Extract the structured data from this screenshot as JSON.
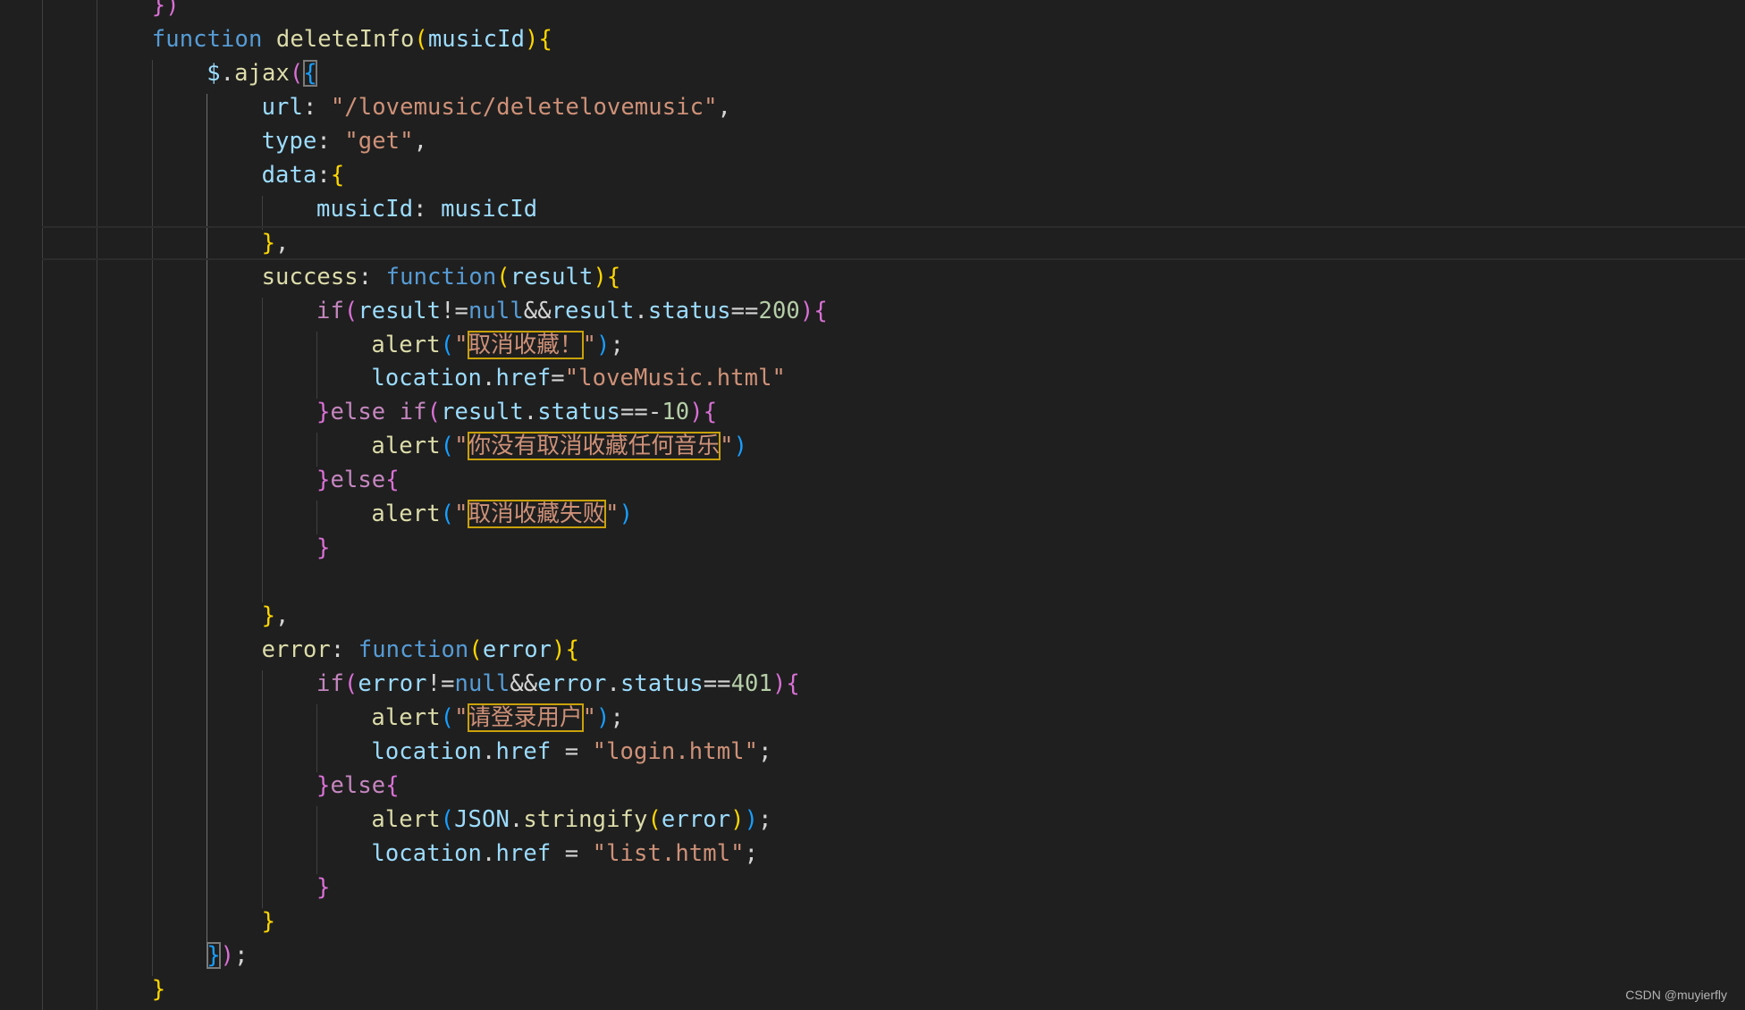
{
  "colors": {
    "background": "#1f1f1f",
    "keyword_storage": "#569cd6",
    "keyword_control": "#c586c0",
    "function_name": "#dcdcaa",
    "variable": "#9cdcfe",
    "string": "#ce9178",
    "number": "#b5cea8",
    "punct": "#d4d4d4",
    "bracket1": "#ffd700",
    "bracket2": "#da70d6",
    "bracket3": "#179fff",
    "highlight_box": "#c9a10a"
  },
  "code_lines": [
    {
      "indent": 2,
      "tokens": [
        [
          "})",
          "b2"
        ]
      ]
    },
    {
      "indent": 2,
      "tokens": [
        [
          "function ",
          "kw"
        ],
        [
          "deleteInfo",
          "fn"
        ],
        [
          "(",
          "b1"
        ],
        [
          "musicId",
          "var"
        ],
        [
          ")",
          "b1"
        ],
        [
          "{",
          "b1"
        ]
      ]
    },
    {
      "indent": 3,
      "tokens": [
        [
          "$",
          "var"
        ],
        [
          ".",
          "p"
        ],
        [
          "ajax",
          "fn"
        ],
        [
          "(",
          "b2"
        ],
        [
          "{",
          "b3",
          "match"
        ]
      ]
    },
    {
      "indent": 4,
      "tokens": [
        [
          "url",
          "var"
        ],
        [
          ": ",
          "p"
        ],
        [
          "\"/lovemusic/deletelovemusic\"",
          "str"
        ],
        [
          ",",
          "p"
        ]
      ]
    },
    {
      "indent": 4,
      "tokens": [
        [
          "type",
          "var"
        ],
        [
          ": ",
          "p"
        ],
        [
          "\"get\"",
          "str"
        ],
        [
          ",",
          "p"
        ]
      ]
    },
    {
      "indent": 4,
      "tokens": [
        [
          "data",
          "var"
        ],
        [
          ":",
          "p"
        ],
        [
          "{",
          "b1"
        ]
      ]
    },
    {
      "indent": 5,
      "tokens": [
        [
          "musicId",
          "var"
        ],
        [
          ": ",
          "p"
        ],
        [
          "musicId",
          "var"
        ]
      ]
    },
    {
      "indent": 4,
      "tokens": [
        [
          "}",
          "b1"
        ],
        [
          ",",
          "p"
        ]
      ]
    },
    {
      "indent": 4,
      "tokens": [
        [
          "success",
          "fn"
        ],
        [
          ": ",
          "p"
        ],
        [
          "function",
          "kw"
        ],
        [
          "(",
          "b1"
        ],
        [
          "result",
          "var"
        ],
        [
          ")",
          "b1"
        ],
        [
          "{",
          "b1"
        ]
      ]
    },
    {
      "indent": 5,
      "tokens": [
        [
          "if",
          "ctl"
        ],
        [
          "(",
          "b2"
        ],
        [
          "result",
          "var"
        ],
        [
          "!=",
          "p"
        ],
        [
          "null",
          "kw"
        ],
        [
          "&&",
          "p"
        ],
        [
          "result",
          "var"
        ],
        [
          ".",
          "p"
        ],
        [
          "status",
          "var"
        ],
        [
          "==",
          "p"
        ],
        [
          "200",
          "num"
        ],
        [
          ")",
          "b2"
        ],
        [
          "{",
          "b2"
        ]
      ]
    },
    {
      "indent": 6,
      "tokens": [
        [
          "alert",
          "fn"
        ],
        [
          "(",
          "b3"
        ],
        [
          "\"",
          "str"
        ],
        [
          "取消收藏！",
          "str",
          "box"
        ],
        [
          "\"",
          "str"
        ],
        [
          ")",
          "b3"
        ],
        [
          ";",
          "p"
        ]
      ]
    },
    {
      "indent": 6,
      "tokens": [
        [
          "location",
          "var"
        ],
        [
          ".",
          "p"
        ],
        [
          "href",
          "var"
        ],
        [
          "=",
          "p"
        ],
        [
          "\"loveMusic.html\"",
          "str"
        ]
      ]
    },
    {
      "indent": 5,
      "tokens": [
        [
          "}",
          "b2"
        ],
        [
          "else ",
          "ctl"
        ],
        [
          "if",
          "ctl"
        ],
        [
          "(",
          "b2"
        ],
        [
          "result",
          "var"
        ],
        [
          ".",
          "p"
        ],
        [
          "status",
          "var"
        ],
        [
          "==-",
          "p"
        ],
        [
          "10",
          "num"
        ],
        [
          ")",
          "b2"
        ],
        [
          "{",
          "b2"
        ]
      ]
    },
    {
      "indent": 6,
      "tokens": [
        [
          "alert",
          "fn"
        ],
        [
          "(",
          "b3"
        ],
        [
          "\"",
          "str"
        ],
        [
          "你没有取消收藏任何音乐",
          "str",
          "box"
        ],
        [
          "\"",
          "str"
        ],
        [
          ")",
          "b3"
        ]
      ]
    },
    {
      "indent": 5,
      "tokens": [
        [
          "}",
          "b2"
        ],
        [
          "else",
          "ctl"
        ],
        [
          "{",
          "b2"
        ]
      ]
    },
    {
      "indent": 6,
      "tokens": [
        [
          "alert",
          "fn"
        ],
        [
          "(",
          "b3"
        ],
        [
          "\"",
          "str"
        ],
        [
          "取消收藏失败",
          "str",
          "box"
        ],
        [
          "\"",
          "str"
        ],
        [
          ")",
          "b3"
        ]
      ]
    },
    {
      "indent": 5,
      "tokens": [
        [
          "}",
          "b2"
        ]
      ]
    },
    {
      "indent": 5,
      "tokens": []
    },
    {
      "indent": 4,
      "tokens": [
        [
          "}",
          "b1"
        ],
        [
          ",",
          "p"
        ]
      ]
    },
    {
      "indent": 4,
      "tokens": [
        [
          "error",
          "fn"
        ],
        [
          ": ",
          "p"
        ],
        [
          "function",
          "kw"
        ],
        [
          "(",
          "b1"
        ],
        [
          "error",
          "var"
        ],
        [
          ")",
          "b1"
        ],
        [
          "{",
          "b1"
        ]
      ]
    },
    {
      "indent": 5,
      "tokens": [
        [
          "if",
          "ctl"
        ],
        [
          "(",
          "b2"
        ],
        [
          "error",
          "var"
        ],
        [
          "!=",
          "p"
        ],
        [
          "null",
          "kw"
        ],
        [
          "&&",
          "p"
        ],
        [
          "error",
          "var"
        ],
        [
          ".",
          "p"
        ],
        [
          "status",
          "var"
        ],
        [
          "==",
          "p"
        ],
        [
          "401",
          "num"
        ],
        [
          ")",
          "b2"
        ],
        [
          "{",
          "b2"
        ]
      ]
    },
    {
      "indent": 6,
      "tokens": [
        [
          "alert",
          "fn"
        ],
        [
          "(",
          "b3"
        ],
        [
          "\"",
          "str"
        ],
        [
          "请登录用户",
          "str",
          "box"
        ],
        [
          "\"",
          "str"
        ],
        [
          ")",
          "b3"
        ],
        [
          ";",
          "p"
        ]
      ]
    },
    {
      "indent": 6,
      "tokens": [
        [
          "location",
          "var"
        ],
        [
          ".",
          "p"
        ],
        [
          "href",
          "var"
        ],
        [
          " = ",
          "p"
        ],
        [
          "\"login.html\"",
          "str"
        ],
        [
          ";",
          "p"
        ]
      ]
    },
    {
      "indent": 5,
      "tokens": [
        [
          "}",
          "b2"
        ],
        [
          "else",
          "ctl"
        ],
        [
          "{",
          "b2"
        ]
      ]
    },
    {
      "indent": 6,
      "tokens": [
        [
          "alert",
          "fn"
        ],
        [
          "(",
          "b3"
        ],
        [
          "JSON",
          "var"
        ],
        [
          ".",
          "p"
        ],
        [
          "stringify",
          "fn"
        ],
        [
          "(",
          "b1"
        ],
        [
          "error",
          "var"
        ],
        [
          ")",
          "b1"
        ],
        [
          ")",
          "b3"
        ],
        [
          ";",
          "p"
        ]
      ]
    },
    {
      "indent": 6,
      "tokens": [
        [
          "location",
          "var"
        ],
        [
          ".",
          "p"
        ],
        [
          "href",
          "var"
        ],
        [
          " = ",
          "p"
        ],
        [
          "\"list.html\"",
          "str"
        ],
        [
          ";",
          "p"
        ]
      ]
    },
    {
      "indent": 5,
      "tokens": [
        [
          "}",
          "b2"
        ]
      ]
    },
    {
      "indent": 4,
      "tokens": [
        [
          "}",
          "b1"
        ]
      ]
    },
    {
      "indent": 3,
      "tokens": [
        [
          "}",
          "b3",
          "match"
        ],
        [
          ")",
          "b2"
        ],
        [
          ";",
          "p"
        ]
      ]
    },
    {
      "indent": 2,
      "tokens": [
        [
          "}",
          "b1"
        ]
      ]
    }
  ],
  "watermark": "CSDN @muyierfly"
}
